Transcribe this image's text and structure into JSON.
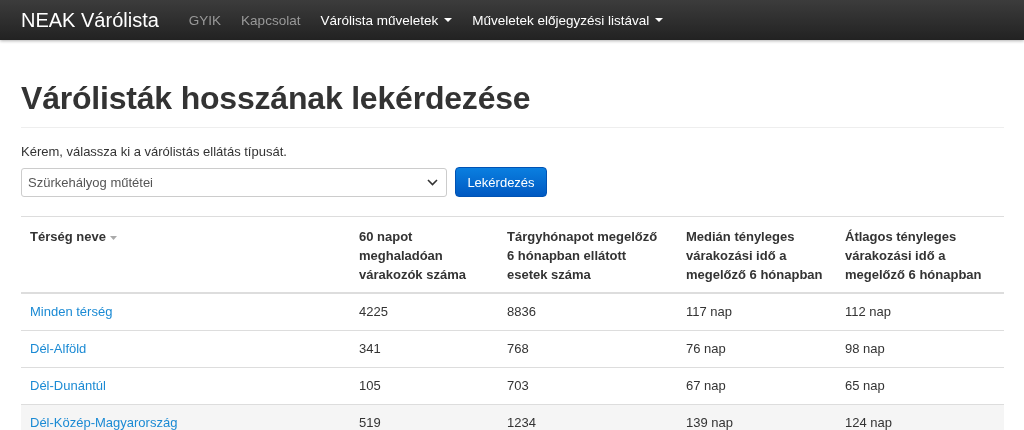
{
  "navbar": {
    "brand": "NEAK Várólista",
    "items": [
      {
        "label": "GYIK",
        "dropdown": false,
        "active": false
      },
      {
        "label": "Kapcsolat",
        "dropdown": false,
        "active": false
      },
      {
        "label": "Várólista műveletek",
        "dropdown": true,
        "active": true
      },
      {
        "label": "Műveletek előjegyzési listával",
        "dropdown": true,
        "active": true
      }
    ]
  },
  "heading": "Várólisták hosszának lekérdezése",
  "instruction": "Kérem, válassza ki a várólistás ellátás típusát.",
  "select": {
    "value": "Szürkehályog műtétei"
  },
  "query_button": "Lekérdezés",
  "table": {
    "columns": [
      {
        "label": "Térség neve",
        "sortable": true
      },
      {
        "label": "60 napot\nmeghaladóan\nvárakozók száma",
        "sortable": false
      },
      {
        "label": "Tárgyhónapot megelőző\n6 hónapban ellátott\nesetek száma",
        "sortable": false
      },
      {
        "label": "Medián tényleges\nvárakozási idő a\nmegelőző 6 hónapban",
        "sortable": false
      },
      {
        "label": "Átlagos tényleges\nvárakozási idő a\nmegelőző 6 hónapban",
        "sortable": false
      }
    ],
    "rows": [
      {
        "cells": [
          "Minden térség",
          "4225",
          "8836",
          "117 nap",
          "112 nap"
        ],
        "highlighted": false
      },
      {
        "cells": [
          "Dél-Alföld",
          "341",
          "768",
          "76 nap",
          "98 nap"
        ],
        "highlighted": false
      },
      {
        "cells": [
          "Dél-Dunántúl",
          "105",
          "703",
          "67 nap",
          "65 nap"
        ],
        "highlighted": false
      },
      {
        "cells": [
          "Dél-Közép-Magyarország",
          "519",
          "1234",
          "139 nap",
          "124 nap"
        ],
        "highlighted": true
      }
    ]
  }
}
